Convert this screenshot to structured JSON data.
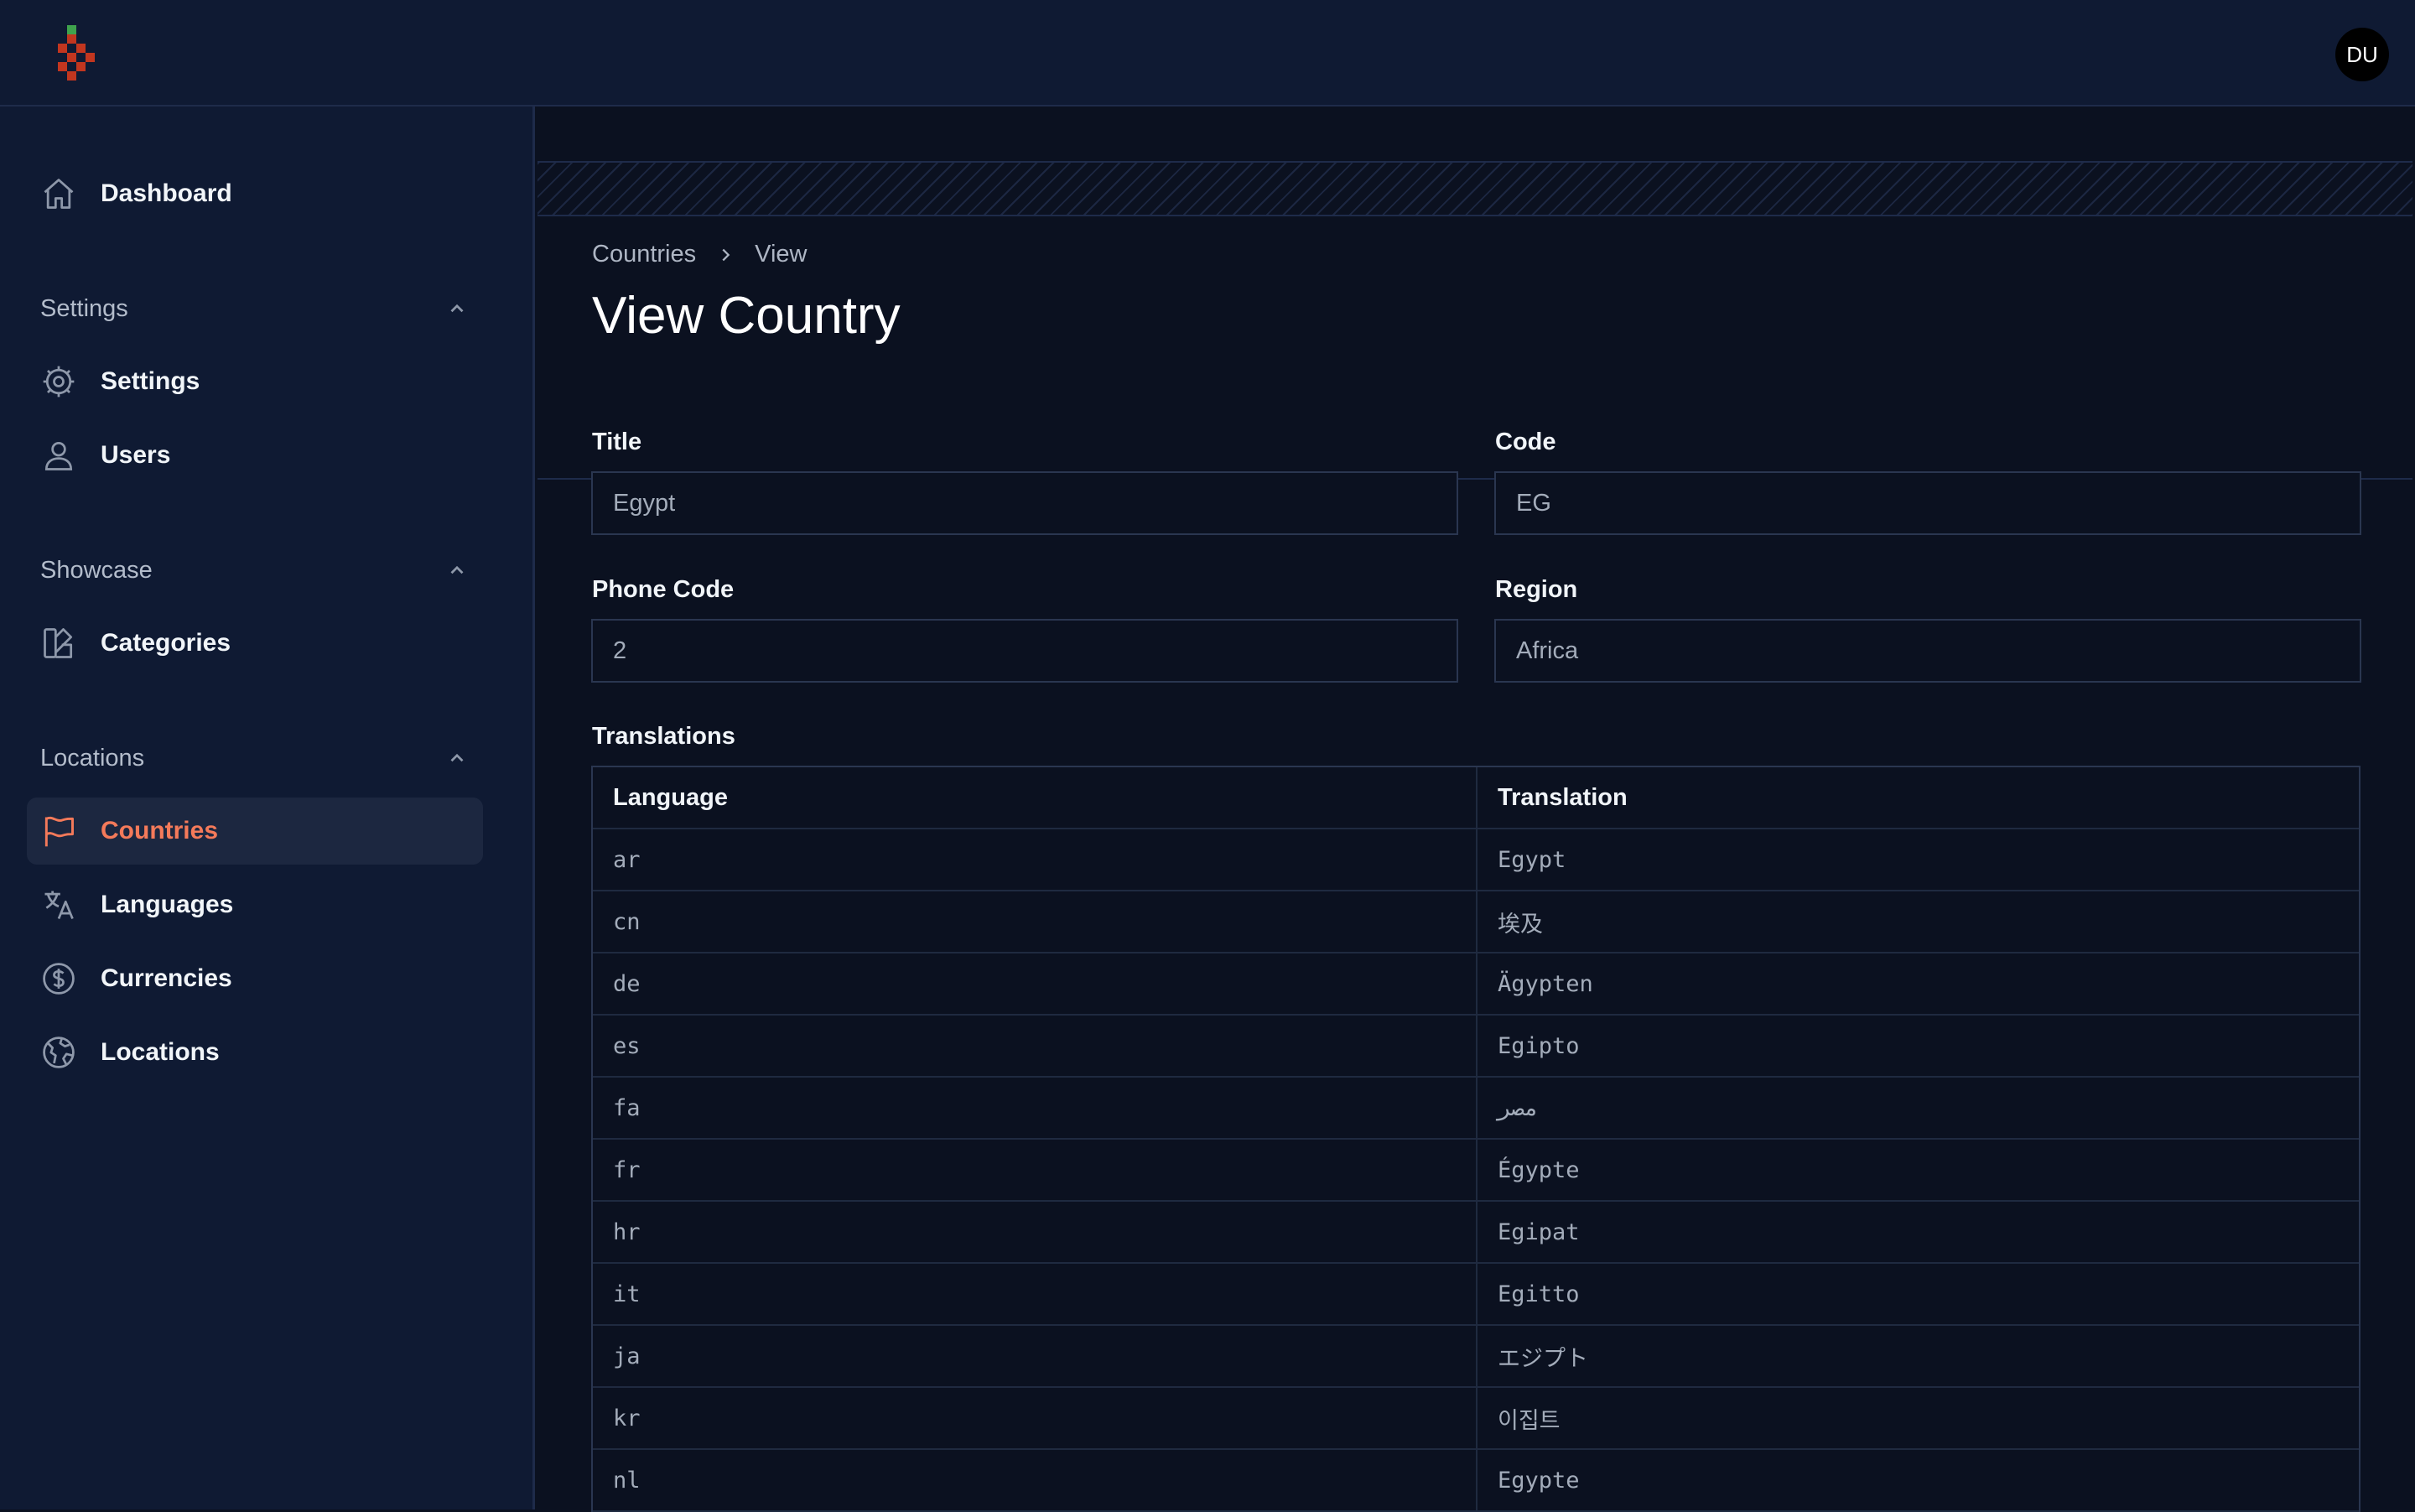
{
  "header": {
    "avatar_initials": "DU"
  },
  "sidebar": {
    "dashboard": "Dashboard",
    "groups": [
      {
        "label": "Settings",
        "items": [
          "Settings",
          "Users"
        ]
      },
      {
        "label": "Showcase",
        "items": [
          "Categories"
        ]
      },
      {
        "label": "Locations",
        "items": [
          "Countries",
          "Languages",
          "Currencies",
          "Locations"
        ]
      }
    ],
    "active_item": "Countries"
  },
  "breadcrumb": {
    "parent": "Countries",
    "current": "View"
  },
  "page_title": "View Country",
  "form": {
    "title": {
      "label": "Title",
      "value": "Egypt"
    },
    "code": {
      "label": "Code",
      "value": "EG"
    },
    "phone_code": {
      "label": "Phone Code",
      "value": "2"
    },
    "region": {
      "label": "Region",
      "value": "Africa"
    }
  },
  "translations": {
    "label": "Translations",
    "columns": [
      "Language",
      "Translation"
    ],
    "rows": [
      [
        "ar",
        "Egypt"
      ],
      [
        "cn",
        "埃及"
      ],
      [
        "de",
        "Ägypten"
      ],
      [
        "es",
        "Egipto"
      ],
      [
        "fa",
        "مصر"
      ],
      [
        "fr",
        "Égypte"
      ],
      [
        "hr",
        "Egipat"
      ],
      [
        "it",
        "Egitto"
      ],
      [
        "ja",
        "エジプト"
      ],
      [
        "kr",
        "이집트"
      ],
      [
        "nl",
        "Egypte"
      ]
    ]
  },
  "colors": {
    "accent": "#f47a5a",
    "background": "#0b1120",
    "sidebar": "#0f1a33"
  }
}
